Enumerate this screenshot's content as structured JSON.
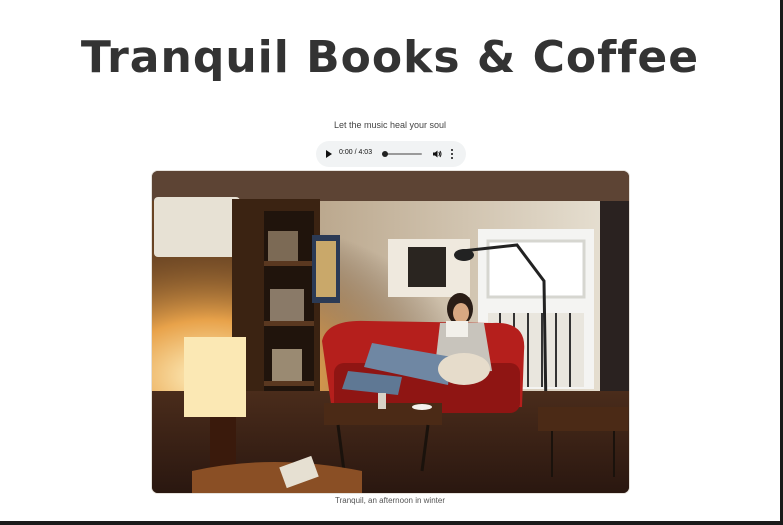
{
  "page": {
    "title": "Tranquil Books & Coffee",
    "tagline": "Let the music heal your soul",
    "caption": "Tranquil, an afternoon in winter"
  },
  "audio_player": {
    "time": "0:00 / 4:03",
    "progress": 0.0,
    "icons": [
      "play-icon",
      "volume-icon",
      "more-options-icon"
    ]
  },
  "photo": {
    "subject": "photo-woman-reading",
    "icons": [
      "lamp-icon",
      "bookshelf-icon",
      "sofa-icon",
      "window-icon"
    ]
  },
  "colors": {
    "title": "#333333",
    "player_bg": "#f1f3f4",
    "frame": "#1a1a1a"
  }
}
